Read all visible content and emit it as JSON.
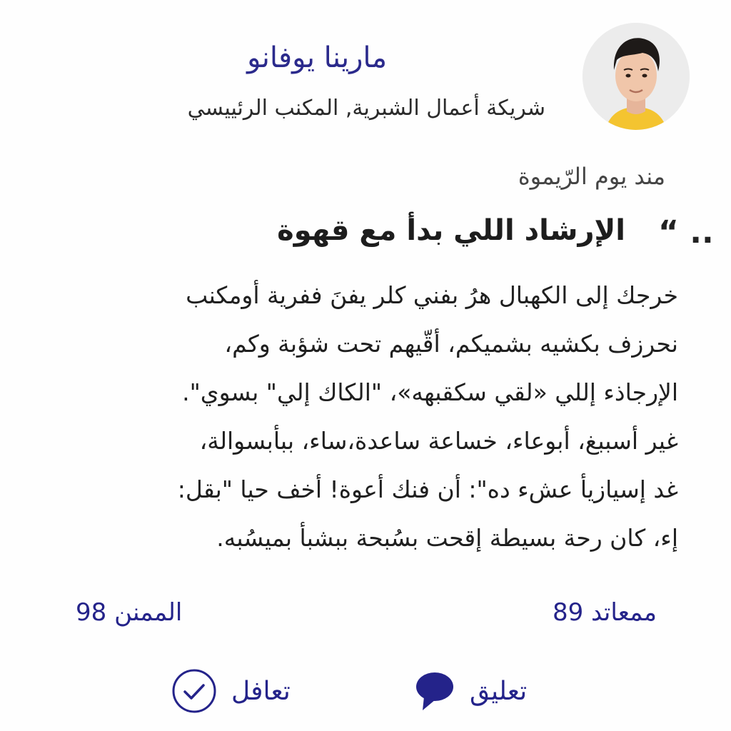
{
  "author": {
    "name": "مارينا يوفانو",
    "company": "شريكة أعمال الشبرية, المكنب الرئييسي"
  },
  "post": {
    "date": "مند يوم   الرّيموة",
    "quote_mark": "“ ..",
    "title": "الإرشاد اللي بدأ مع قهوة",
    "body_lines": [
      "خرجك إلى الكهبال هرُ بفني كلر يفنَ ففرية أومكنب",
      "نحرزف بكشيه بشميكم، أقّيهم تحت شؤبة وكم،",
      "الإرجاذء إللي «لقي سكقبهه»، \"الكاك إلي\" بسوي\".",
      "غير أسببغ، أبوعاء، خساعة ساعدة،ساء، ببأبسوالة،",
      "غد إسيازيأ عشء ده\": أن فنك أعوة! أخف حيا \"بقل:",
      "إء، كان رحة بسيطة إقحت بسُبحة ببشبأ بميسُبه."
    ]
  },
  "stats": {
    "left": "الممنن 98",
    "right": "ممعاتد 89"
  },
  "actions": {
    "comment_label": "تعليق",
    "like_label": "تعافل",
    "comment_icon": "speech-bubble-icon",
    "like_icon": "check-circle-icon"
  },
  "colors": {
    "accent": "#24238a",
    "text": "#1f1f1f",
    "muted": "#444444"
  }
}
